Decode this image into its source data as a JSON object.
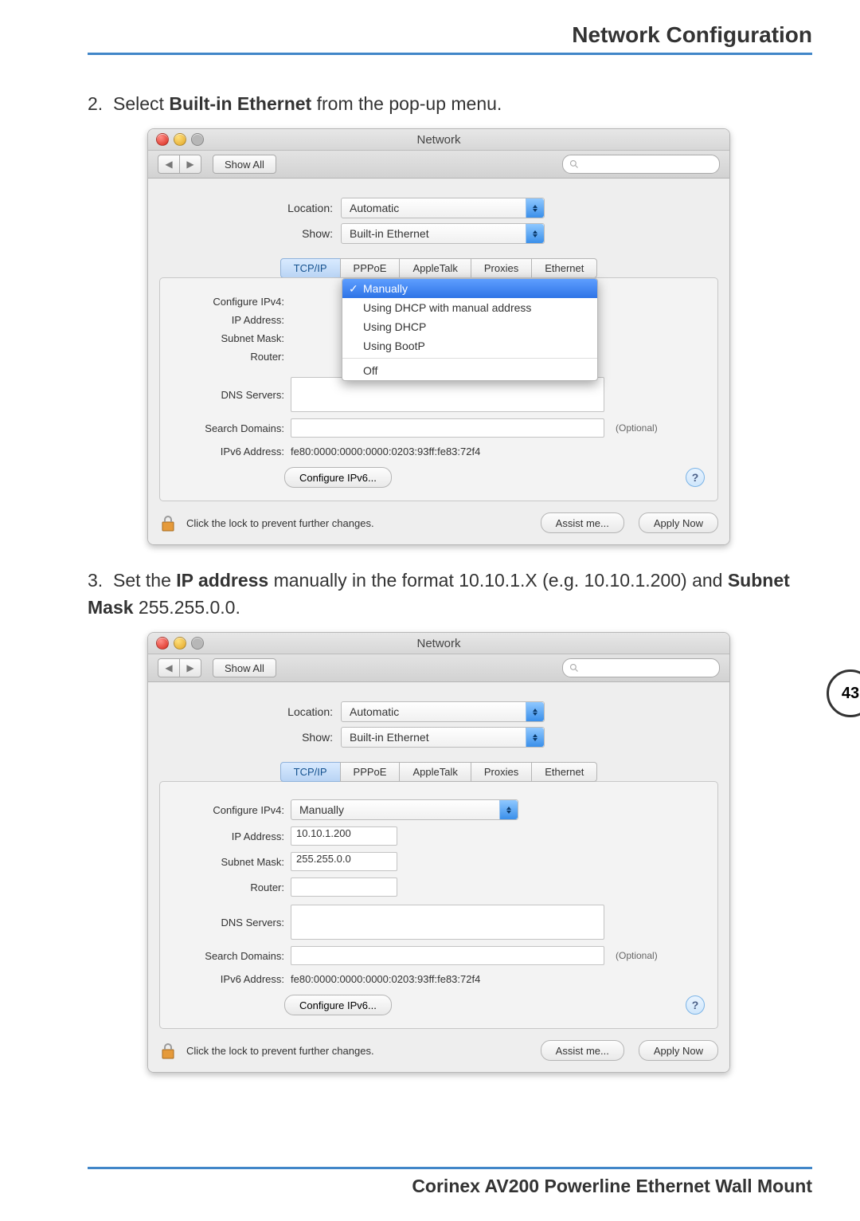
{
  "page_title": "Network Configuration",
  "page_number": "43",
  "footer": "Corinex AV200 Powerline Ethernet Wall Mount",
  "step2": {
    "num": "2.",
    "pre": "Select ",
    "bold": "Built-in Ethernet",
    "post": " from the pop-up menu."
  },
  "step3": {
    "num": "3.",
    "pre": "Set the ",
    "bold1": "IP address",
    "mid": " manually in the format 10.10.1.X (e.g. 10.10.1.200) and ",
    "bold2": "Subnet Mask",
    "post": " 255.255.0.0."
  },
  "win": {
    "title": "Network",
    "show_all": "Show All",
    "location_label": "Location:",
    "location_value": "Automatic",
    "show_label": "Show:",
    "show_value": "Built-in Ethernet",
    "tabs": [
      "TCP/IP",
      "PPPoE",
      "AppleTalk",
      "Proxies",
      "Ethernet"
    ],
    "labels": {
      "configure_ipv4": "Configure IPv4:",
      "ip_address": "IP Address:",
      "subnet_mask": "Subnet Mask:",
      "router": "Router:",
      "dns_servers": "DNS Servers:",
      "search_domains": "Search Domains:",
      "ipv6_address": "IPv6 Address:",
      "optional": "(Optional)"
    },
    "ipv6_value": "fe80:0000:0000:0000:0203:93ff:fe83:72f4",
    "configure_ipv6_btn": "Configure IPv6...",
    "lock_text": "Click the lock to prevent further changes.",
    "assist_btn": "Assist me...",
    "apply_btn": "Apply Now"
  },
  "menu_items": {
    "manually": "Manually",
    "dhcp_manual": "Using DHCP with manual address",
    "dhcp": "Using DHCP",
    "bootp": "Using BootP",
    "off": "Off"
  },
  "shot2": {
    "configure_value": "Manually",
    "ip_value": "10.10.1.200",
    "subnet_value": "255.255.0.0"
  }
}
